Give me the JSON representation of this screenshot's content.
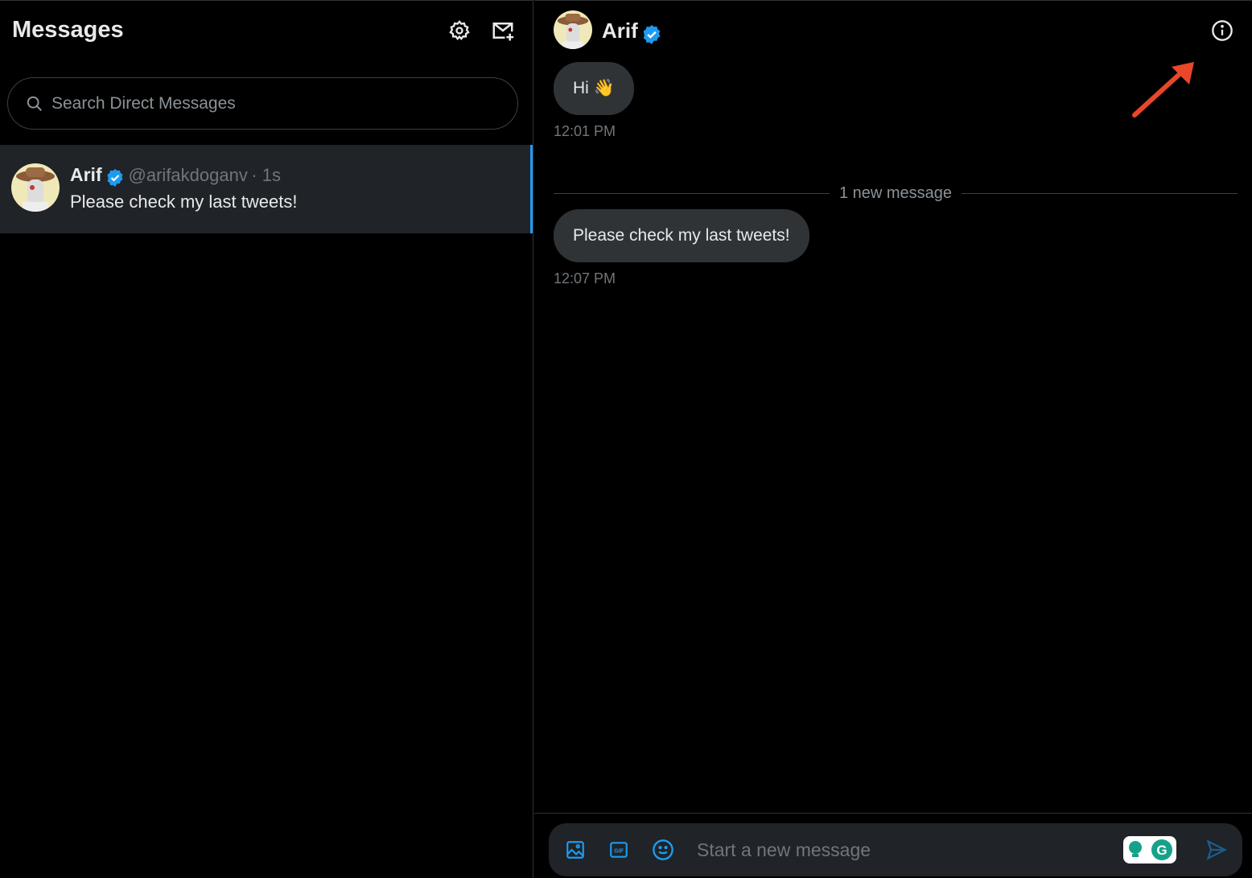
{
  "left": {
    "title": "Messages",
    "search_placeholder": "Search Direct Messages",
    "conversation": {
      "name": "Arif",
      "handle": "@arifakdoganv",
      "time": "· 1s",
      "preview": "Please check my last tweets!"
    }
  },
  "chat": {
    "name": "Arif",
    "messages": [
      {
        "text": "Hi 👋",
        "time": "12:01 PM"
      },
      {
        "text": "Please check my last tweets!",
        "time": "12:07 PM"
      }
    ],
    "divider": "1 new message",
    "composer_placeholder": "Start a new message"
  },
  "colors": {
    "accent": "#1d9bf0",
    "annotation": "#e8472a"
  }
}
